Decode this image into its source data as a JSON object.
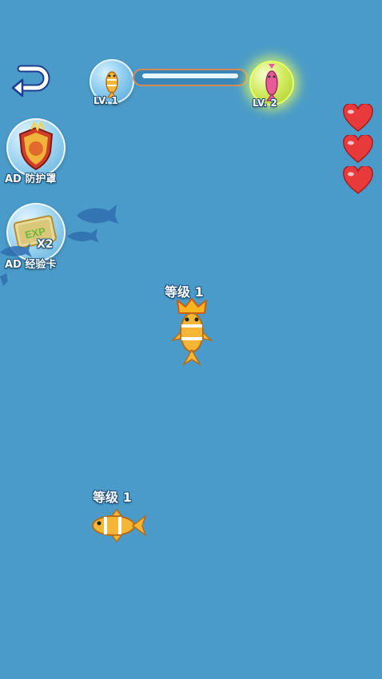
{
  "hud": {
    "back_icon": "return-arrow-icon",
    "level_current": "LV. 1",
    "level_next": "LV. 2",
    "progress": 0.0
  },
  "powerups": {
    "shield_label": "AD 防护罩",
    "exp_label": "AD 经验卡",
    "exp_multiplier": "X2",
    "exp_card_text": "EXP"
  },
  "lives": {
    "count": 3,
    "icon": "heart-icon",
    "color": "#e8393b"
  },
  "player": {
    "level_label": "等级 1",
    "icon": "crown-icon"
  },
  "enemy": {
    "level_label": "等级 1"
  },
  "colors": {
    "water": "#4a9bc9",
    "fish": "#f5b638",
    "fish_stripe": "#ffffff",
    "shadow_fish": "#2f6fb0"
  }
}
